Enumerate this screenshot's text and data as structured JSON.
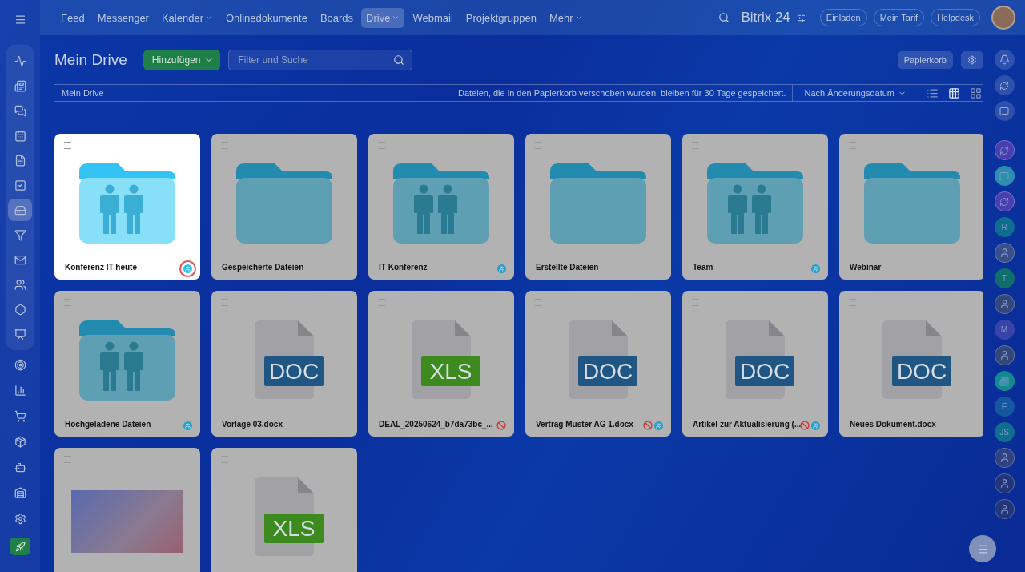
{
  "top_nav": {
    "items": [
      {
        "label": "Feed",
        "selected": false,
        "caret": false
      },
      {
        "label": "Messenger",
        "selected": false,
        "caret": false
      },
      {
        "label": "Kalender",
        "selected": false,
        "caret": true
      },
      {
        "label": "Onlinedokumente",
        "selected": false,
        "caret": false
      },
      {
        "label": "Boards",
        "selected": false,
        "caret": false
      },
      {
        "label": "Drive",
        "selected": true,
        "caret": true
      },
      {
        "label": "Webmail",
        "selected": false,
        "caret": false
      },
      {
        "label": "Projektgruppen",
        "selected": false,
        "caret": false
      },
      {
        "label": "Mehr",
        "selected": false,
        "caret": true
      }
    ],
    "logo": "Bitrix",
    "logo_number": "24",
    "buttons": [
      "Einladen",
      "Mein Tarif",
      "Helpdesk"
    ]
  },
  "left_sidebar": {
    "items": [
      {
        "kind": "activity",
        "selected": false
      },
      {
        "kind": "news",
        "selected": false
      },
      {
        "kind": "chat",
        "selected": false
      },
      {
        "kind": "calendar",
        "selected": false
      },
      {
        "kind": "document",
        "selected": false
      },
      {
        "kind": "tasks",
        "selected": false
      },
      {
        "kind": "drive",
        "selected": true
      },
      {
        "kind": "funnel",
        "selected": false
      },
      {
        "kind": "mail",
        "selected": false
      },
      {
        "kind": "people",
        "selected": false
      },
      {
        "kind": "hexagon",
        "selected": false
      },
      {
        "kind": "presentation",
        "selected": false
      },
      {
        "kind": "target",
        "selected": false
      },
      {
        "kind": "chart",
        "selected": false
      },
      {
        "kind": "cart",
        "selected": false
      },
      {
        "kind": "box",
        "selected": false
      },
      {
        "kind": "bot",
        "selected": false
      },
      {
        "kind": "store",
        "selected": false
      },
      {
        "kind": "settings",
        "selected": false
      }
    ]
  },
  "page": {
    "title": "Mein Drive",
    "add_button": "Hinzufügen",
    "search": {
      "placeholder": "Filter und Suche"
    },
    "trash_button": "Papierkorb",
    "breadcrumb": "Mein Drive",
    "notice": "Dateien, die in den Papierkorb verschoben wurden, bleiben für 30 Tage gespeichert.",
    "sort": "Nach Änderungsdatum",
    "views": [
      {
        "kind": "list",
        "selected": false
      },
      {
        "kind": "grid",
        "selected": true
      },
      {
        "kind": "tiles",
        "selected": false
      }
    ]
  },
  "cards": [
    {
      "kind": "folder",
      "shared_folder": true,
      "title": "Konferenz IT heute",
      "blocked": false,
      "shared": true,
      "spotlight": true
    },
    {
      "kind": "folder",
      "shared_folder": false,
      "title": "Gespeicherte Dateien",
      "blocked": false,
      "shared": false,
      "spotlight": false
    },
    {
      "kind": "folder",
      "shared_folder": true,
      "title": "IT Konferenz",
      "blocked": false,
      "shared": true,
      "spotlight": false
    },
    {
      "kind": "folder",
      "shared_folder": false,
      "title": "Erstellte Dateien",
      "blocked": false,
      "shared": false,
      "spotlight": false
    },
    {
      "kind": "folder",
      "shared_folder": true,
      "title": "Team",
      "blocked": false,
      "shared": true,
      "spotlight": false
    },
    {
      "kind": "folder",
      "shared_folder": false,
      "title": "Webinar",
      "blocked": false,
      "shared": false,
      "spotlight": false
    },
    {
      "kind": "folder",
      "shared_folder": true,
      "title": "Hochgeladene Dateien",
      "blocked": false,
      "shared": true,
      "spotlight": false
    },
    {
      "kind": "doc",
      "file_label": "DOC",
      "title": "Vorlage 03.docx",
      "blocked": false,
      "shared": false,
      "spotlight": false
    },
    {
      "kind": "xls",
      "file_label": "XLS",
      "title": "DEAL_20250624_b7da73bc_...",
      "blocked": true,
      "shared": false,
      "spotlight": false
    },
    {
      "kind": "doc",
      "file_label": "DOC",
      "title": "Vertrag Muster AG 1.docx",
      "blocked": true,
      "shared": true,
      "spotlight": false
    },
    {
      "kind": "doc",
      "file_label": "DOC",
      "title": "Artikel zur Aktualisierung (...",
      "blocked": true,
      "shared": true,
      "spotlight": false
    },
    {
      "kind": "doc",
      "file_label": "DOC",
      "title": "Neues Dokument.docx",
      "blocked": false,
      "shared": false,
      "spotlight": false
    },
    {
      "kind": "image",
      "spotlight": false,
      "blocked": false,
      "shared": false
    },
    {
      "kind": "xls",
      "file_label": "XLS",
      "spotlight": false,
      "blocked": false,
      "shared": false
    }
  ],
  "right_sidebar": {
    "items": [
      {
        "kind": "icon",
        "color": "#4a3fb0"
      },
      {
        "kind": "chat",
        "color": "#2a8fb0"
      },
      {
        "kind": "icon",
        "color": "#4a3fb0"
      },
      {
        "kind": "letter",
        "text": "R",
        "color": "#0f6e8f"
      },
      {
        "kind": "photo",
        "color": "#3a4f8a"
      },
      {
        "kind": "hex",
        "text": "T",
        "color": "#0f6e6a"
      },
      {
        "kind": "photo",
        "color": "#34477a"
      },
      {
        "kind": "letter",
        "text": "M",
        "color": "#3a44a8"
      },
      {
        "kind": "photo",
        "color": "#34477a"
      },
      {
        "kind": "news",
        "color": "#138a8f"
      },
      {
        "kind": "letter",
        "text": "E",
        "color": "#1459a0"
      },
      {
        "kind": "letter",
        "text": "JS",
        "color": "#0f6e8f"
      },
      {
        "kind": "photo",
        "color": "#2f4282"
      },
      {
        "kind": "photo",
        "color": "#22357a"
      },
      {
        "kind": "photo",
        "color": "#22357a"
      }
    ]
  }
}
